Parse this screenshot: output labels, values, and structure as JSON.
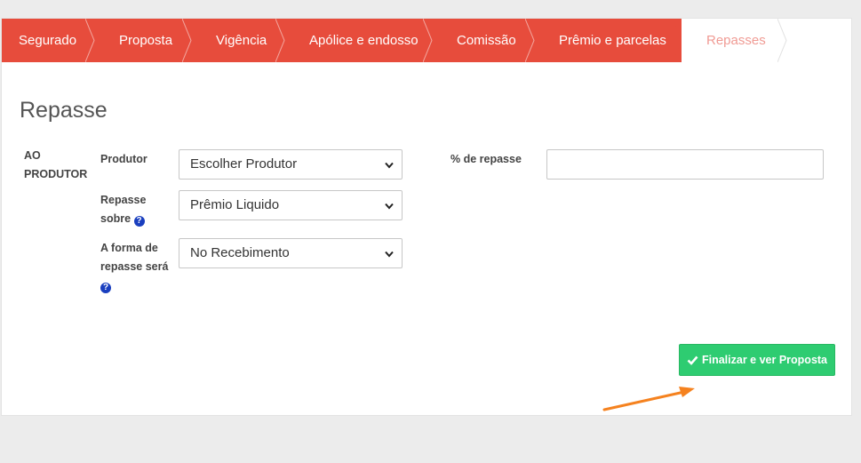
{
  "wizard": {
    "steps": [
      {
        "label": "Segurado"
      },
      {
        "label": "Proposta"
      },
      {
        "label": "Vigência"
      },
      {
        "label": "Apólice e endosso"
      },
      {
        "label": "Comissão"
      },
      {
        "label": "Prêmio e parcelas"
      },
      {
        "label": "Repasses"
      }
    ],
    "active_index": 6,
    "active_color": "#e74c3c"
  },
  "section": {
    "title": "Repasse",
    "group_label": "AO PRODUTOR"
  },
  "form": {
    "produtor": {
      "label": "Produtor",
      "value": "Escolher Produtor"
    },
    "repasse_sobre": {
      "label_line1": "Repasse",
      "label_line2": "sobre",
      "value": "Prêmio Liquido"
    },
    "forma_repasse": {
      "label_line1": "A forma de",
      "label_line2": "repasse será",
      "value": "No Recebimento"
    },
    "percentual": {
      "label": "% de repasse",
      "value": ""
    }
  },
  "actions": {
    "finish_label": "Finalizar e ver Proposta",
    "finish_color": "#2ecc71"
  },
  "annotation": {
    "arrow_color": "#f5821f"
  }
}
